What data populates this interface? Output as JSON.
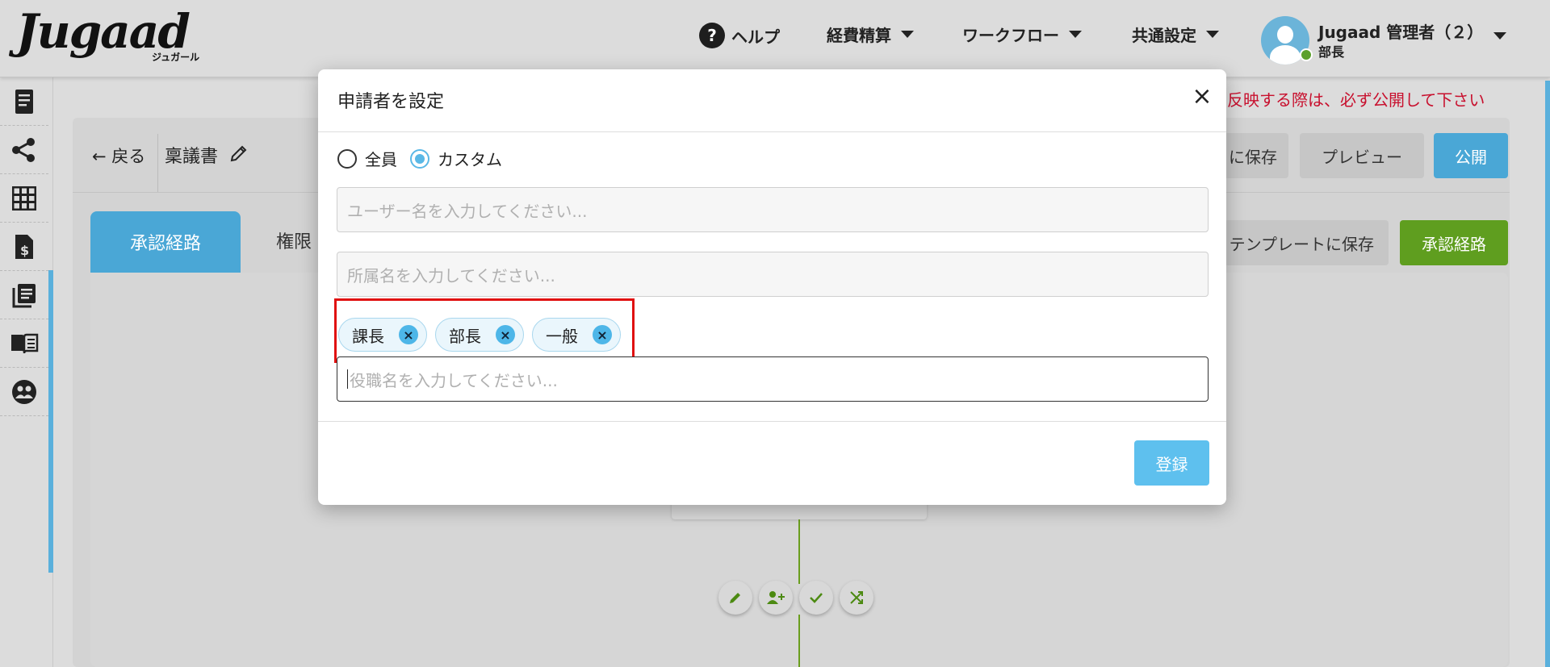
{
  "header": {
    "logo": "Jugaad",
    "logo_sub": "ジュガール",
    "nav": {
      "help": "ヘルプ",
      "expense": "経費精算",
      "workflow": "ワークフロー",
      "common": "共通設定"
    },
    "user": {
      "name": "Jugaad 管理者（２）",
      "role": "部長"
    }
  },
  "sidebar": {
    "items": [
      {
        "icon": "receipt-icon"
      },
      {
        "icon": "share-icon"
      },
      {
        "icon": "grid-icon"
      },
      {
        "icon": "invoice-icon"
      },
      {
        "icon": "documents-icon"
      },
      {
        "icon": "book-icon"
      },
      {
        "icon": "group-icon"
      }
    ]
  },
  "page": {
    "warning": "ん。反映する際は、必ず公開して下さい",
    "back": "← 戻る",
    "doc_title": "稟議書",
    "buttons": {
      "save_partial": "に保存",
      "preview": "プレビュー",
      "publish": "公開",
      "save_template": "テンプレートに保存",
      "route": "承認経路"
    },
    "tabs": {
      "active": "承認経路",
      "other": "権限"
    }
  },
  "modal": {
    "title": "申請者を設定",
    "close": "×",
    "radios": {
      "all": "全員",
      "custom": "カスタム",
      "selected": "custom"
    },
    "user_input_placeholder": "ユーザー名を入力してください...",
    "dept_input_placeholder": "所属名を入力してください...",
    "position_input_placeholder": "役職名を入力してください...",
    "chips": [
      "課長",
      "部長",
      "一般"
    ],
    "chip_remove": "×",
    "submit": "登録"
  },
  "colors": {
    "primary_blue": "#4aa7d6",
    "chip_blue": "#4db6e8",
    "green": "#5f9e1f",
    "warning_red": "#c8102e",
    "highlight_red": "#e01010"
  }
}
